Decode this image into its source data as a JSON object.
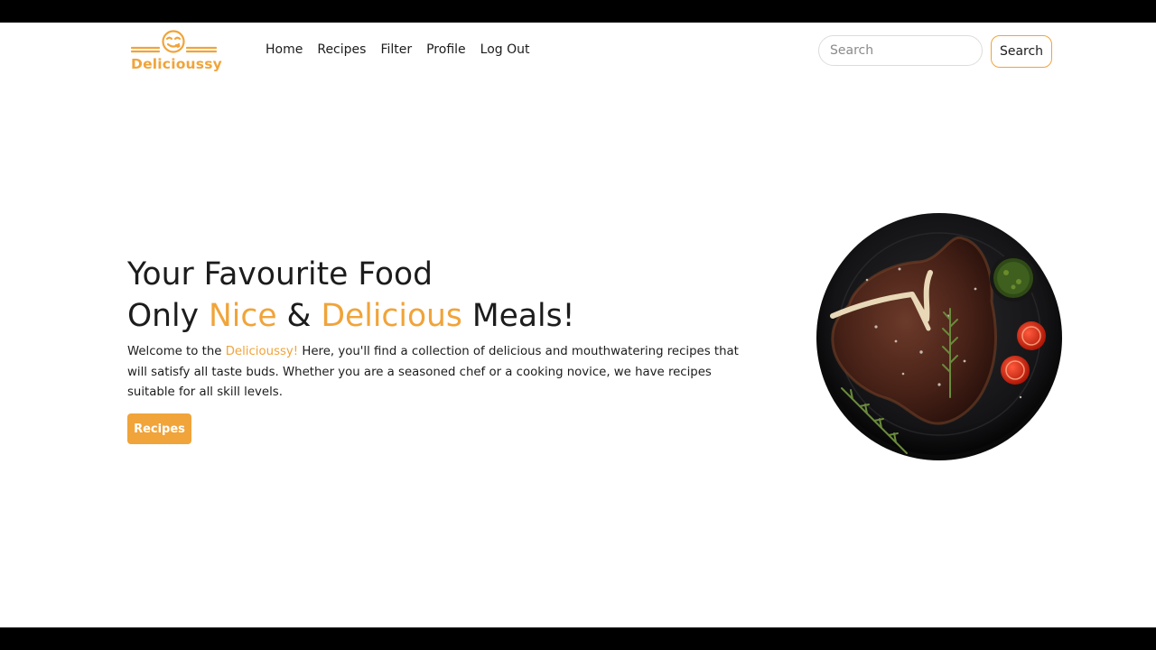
{
  "brand": {
    "name": "Delicioussy",
    "accent_color": "#f0a43a",
    "logo_icon": "smiling-chef-face-icon"
  },
  "nav": {
    "items": [
      {
        "label": "Home"
      },
      {
        "label": "Recipes"
      },
      {
        "label": "Filter"
      },
      {
        "label": "Profile"
      },
      {
        "label": "Log Out"
      }
    ]
  },
  "search": {
    "placeholder": "Search",
    "value": "",
    "button_label": "Search"
  },
  "hero": {
    "title_line1": "Your Favourite Food",
    "title_line2_prefix": "Only ",
    "title_line2_accent1": "Nice",
    "title_line2_amp": " & ",
    "title_line2_accent2": "Delicious",
    "title_line2_suffix": " Meals!",
    "desc_prefix": "Welcome to the ",
    "desc_brand": "Delicioussy!",
    "desc_rest": " Here, you'll find a collection of delicious and mouthwatering recipes that will satisfy all taste buds. Whether you are a seasoned chef or a cooking novice, we have recipes suitable for all skill levels.",
    "cta_label": "Recipes",
    "image_icon": "steak-plate-image"
  }
}
